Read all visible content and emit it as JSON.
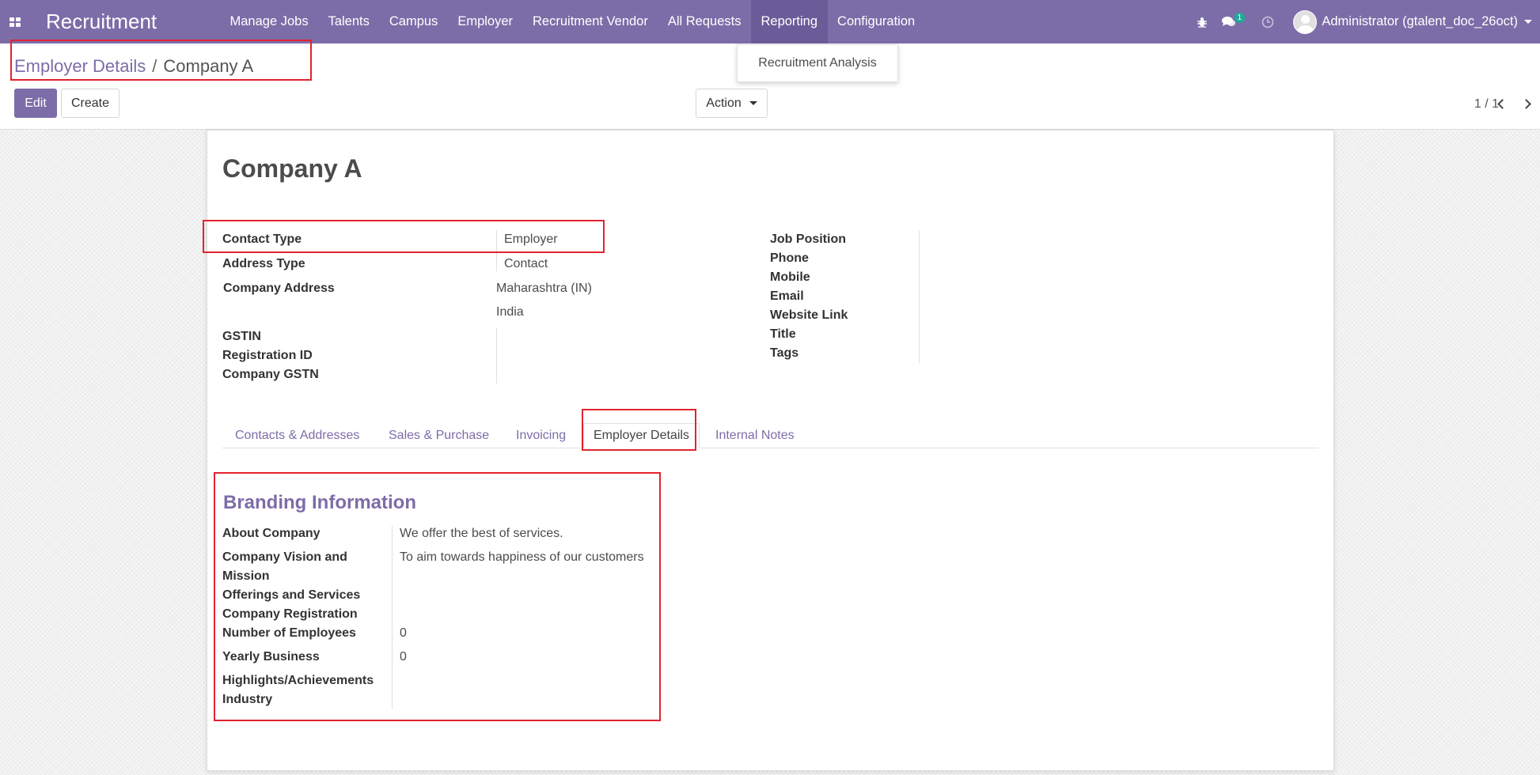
{
  "navbar": {
    "app_name": "Recruitment",
    "menu": [
      "Manage Jobs",
      "Talents",
      "Campus",
      "Employer",
      "Recruitment Vendor",
      "All Requests",
      "Reporting",
      "Configuration"
    ],
    "active_menu": "Reporting",
    "messages_count": "1",
    "user": "Administrator (gtalent_doc_26oct)",
    "accent_color": "#7c6da8"
  },
  "dropdown": {
    "items": [
      "Recruitment Analysis"
    ]
  },
  "control_panel": {
    "breadcrumb_parent": "Employer Details",
    "breadcrumb_sep": "/",
    "breadcrumb_current": "Company A",
    "edit_label": "Edit",
    "create_label": "Create",
    "action_label": "Action",
    "pager": "1 / 1"
  },
  "record": {
    "title": "Company A",
    "left_fields": {
      "contact_type_label": "Contact Type",
      "contact_type_value": "Employer",
      "address_type_label": "Address Type",
      "address_type_value": "Contact",
      "company_address_label": "Company Address",
      "address_line1": "Maharashtra (IN)",
      "address_line2": "India",
      "gstin_label": "GSTIN",
      "registration_id_label": "Registration ID",
      "company_gstn_label": "Company GSTN"
    },
    "right_fields": [
      "Job Position",
      "Phone",
      "Mobile",
      "Email",
      "Website Link",
      "Title",
      "Tags"
    ]
  },
  "tabs": [
    "Contacts & Addresses",
    "Sales & Purchase",
    "Invoicing",
    "Employer Details",
    "Internal Notes"
  ],
  "active_tab": "Employer Details",
  "branding": {
    "section_title": "Branding Information",
    "about_label": "About Company",
    "about_value": "We offer the best of services.",
    "vision_label_1": "Company Vision and",
    "vision_label_2": "Mission",
    "vision_value": "To aim towards happiness of our customers",
    "offerings_label": "Offerings and Services",
    "registration_label": "Company Registration",
    "employees_label": "Number of Employees",
    "employees_value": "0",
    "yearly_label": "Yearly Business",
    "yearly_value": "0",
    "highlights_label": "Highlights/Achievements",
    "industry_label": "Industry"
  }
}
